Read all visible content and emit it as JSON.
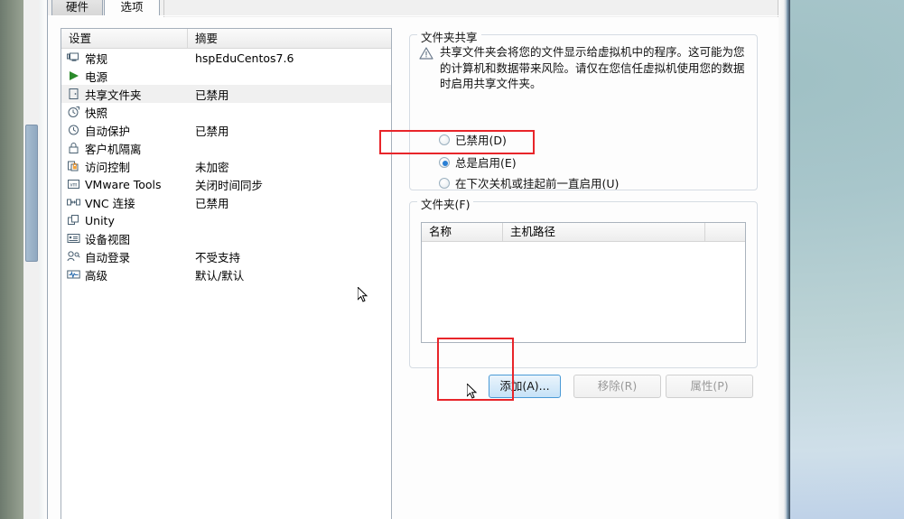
{
  "tabs": [
    {
      "label": "硬件",
      "active": false
    },
    {
      "label": "选项",
      "active": true
    }
  ],
  "settings_list": {
    "headers": {
      "name": "设置",
      "summary": "摘要"
    },
    "rows": [
      {
        "icon": "monitor-icon",
        "label": "常规",
        "summary": "hspEduCentos7.6",
        "selected": false
      },
      {
        "icon": "power-play-icon",
        "label": "电源",
        "summary": "",
        "selected": false
      },
      {
        "icon": "shared-folder-icon",
        "label": "共享文件夹",
        "summary": "已禁用",
        "selected": true
      },
      {
        "icon": "snapshot-icon",
        "label": "快照",
        "summary": "",
        "selected": false
      },
      {
        "icon": "autoprotect-clock-icon",
        "label": "自动保护",
        "summary": "已禁用",
        "selected": false
      },
      {
        "icon": "lock-icon",
        "label": "客户机隔离",
        "summary": "",
        "selected": false
      },
      {
        "icon": "access-control-icon",
        "label": "访问控制",
        "summary": "未加密",
        "selected": false
      },
      {
        "icon": "vmware-tools-icon",
        "label": "VMware Tools",
        "summary": "关闭时间同步",
        "selected": false
      },
      {
        "icon": "vnc-icon",
        "label": "VNC 连接",
        "summary": "已禁用",
        "selected": false
      },
      {
        "icon": "unity-icon",
        "label": "Unity",
        "summary": "",
        "selected": false
      },
      {
        "icon": "device-view-icon",
        "label": "设备视图",
        "summary": "",
        "selected": false
      },
      {
        "icon": "autologin-icon",
        "label": "自动登录",
        "summary": "不受支持",
        "selected": false
      },
      {
        "icon": "advanced-icon",
        "label": "高级",
        "summary": "默认/默认",
        "selected": false
      }
    ]
  },
  "sharing_group": {
    "title": "文件夹共享",
    "warning_icon": "warning-triangle-icon",
    "warning_text": "共享文件夹会将您的文件显示给虚拟机中的程序。这可能为您的计算机和数据带来风险。请仅在您信任虚拟机使用您的数据时启用共享文件夹。",
    "radios": [
      {
        "label": "已禁用(D)",
        "checked": false
      },
      {
        "label": "总是启用(E)",
        "checked": true
      },
      {
        "label": "在下次关机或挂起前一直启用(U)",
        "checked": false
      }
    ]
  },
  "folders_group": {
    "title": "文件夹(F)",
    "columns": [
      "名称",
      "主机路径",
      ""
    ],
    "rows": []
  },
  "buttons": {
    "add": {
      "label": "添加(A)...",
      "state": "hover"
    },
    "remove": {
      "label": "移除(R)",
      "state": "disabled"
    },
    "properties": {
      "label": "属性(P)",
      "state": "disabled"
    }
  },
  "colors": {
    "highlight_red": "#e8252a",
    "accent_blue": "#2a7fd4",
    "selected_row": "#f0f0f0"
  }
}
